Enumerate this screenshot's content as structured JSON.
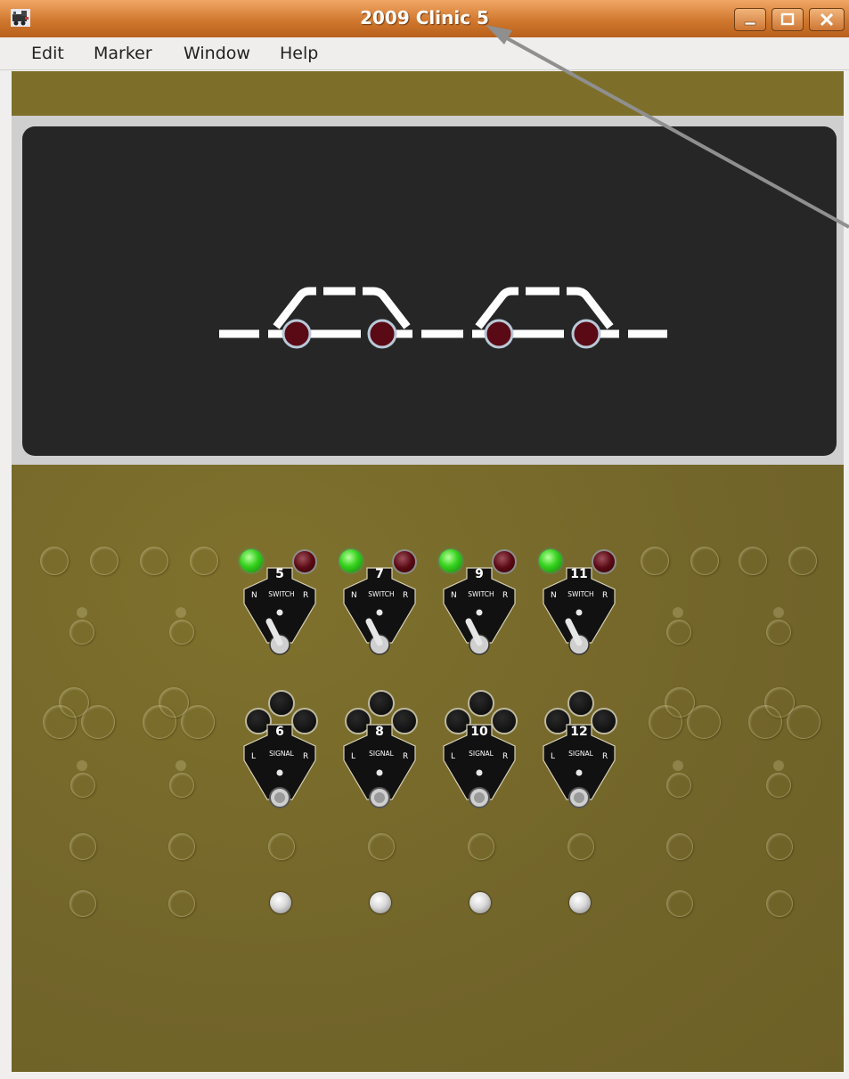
{
  "window": {
    "title": "2009 Clinic 5",
    "app_icon": "locomotive-icon",
    "controls": [
      "minimize-icon",
      "maximize-icon",
      "close-icon"
    ],
    "title_color": "#d1782f"
  },
  "menu": [
    "Edit",
    "Marker",
    "Window",
    "Help"
  ],
  "panel": {
    "background_color": "#7d6f2a",
    "track_panel_color": "#262626",
    "turnout_indicators": 4,
    "switch_levers": [
      {
        "number": "5",
        "label": "SWITCH",
        "left": "N",
        "right": "R"
      },
      {
        "number": "7",
        "label": "SWITCH",
        "left": "N",
        "right": "R"
      },
      {
        "number": "9",
        "label": "SWITCH",
        "left": "N",
        "right": "R"
      },
      {
        "number": "11",
        "label": "SWITCH",
        "left": "N",
        "right": "R"
      }
    ],
    "signal_levers": [
      {
        "number": "6",
        "label": "SIGNAL",
        "left": "L",
        "right": "R"
      },
      {
        "number": "8",
        "label": "SIGNAL",
        "left": "L",
        "right": "R"
      },
      {
        "number": "10",
        "label": "SIGNAL",
        "left": "L",
        "right": "R"
      },
      {
        "number": "12",
        "label": "SIGNAL",
        "left": "L",
        "right": "R"
      }
    ],
    "lamp_colors": {
      "normal": "#34d21c",
      "reverse": "#5a0a14"
    }
  }
}
